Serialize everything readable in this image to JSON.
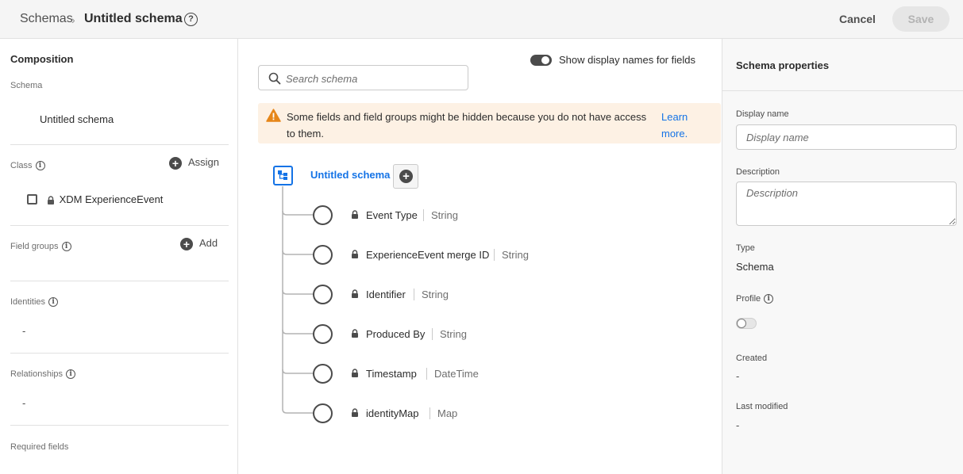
{
  "header": {
    "breadcrumb_root": "Schemas",
    "breadcrumb_separator": "›",
    "breadcrumb_current": "Untitled schema",
    "help_icon": "?",
    "cancel_label": "Cancel",
    "save_label": "Save"
  },
  "composition": {
    "title": "Composition",
    "schema_label": "Schema",
    "schema_name": "Untitled schema",
    "class_label": "Class",
    "assign_label": "Assign",
    "class_name": "XDM ExperienceEvent",
    "field_groups_label": "Field groups",
    "add_label": "Add",
    "identities_label": "Identities",
    "identities_value": "-",
    "relationships_label": "Relationships",
    "relationships_value": "-",
    "required_fields_label": "Required fields",
    "info_glyph": "i",
    "plus_glyph": "+"
  },
  "canvas": {
    "search_placeholder": "Search schema",
    "toggle_label": "Show display names for fields",
    "toggle_on": true,
    "alert_text": "Some fields and field groups might be hidden because you do not have access to them.",
    "alert_link": "Learn more.",
    "root_name": "Untitled schema",
    "fields": [
      {
        "name": "Event Type",
        "type": "String"
      },
      {
        "name": "ExperienceEvent merge ID",
        "type": "String"
      },
      {
        "name": "Identifier",
        "type": "String"
      },
      {
        "name": "Produced By",
        "type": "String"
      },
      {
        "name": "Timestamp",
        "type": "DateTime"
      },
      {
        "name": "identityMap",
        "type": "Map"
      }
    ]
  },
  "properties": {
    "title": "Schema properties",
    "display_name_label": "Display name",
    "display_name_placeholder": "Display name",
    "description_label": "Description",
    "description_placeholder": "Description",
    "type_label": "Type",
    "type_value": "Schema",
    "profile_label": "Profile",
    "profile_enabled": false,
    "created_label": "Created",
    "created_value": "-",
    "last_modified_label": "Last modified",
    "last_modified_value": "-"
  },
  "colors": {
    "accent": "#1473e6",
    "warning": "#e68619",
    "alert_bg": "#fdf1e4"
  }
}
